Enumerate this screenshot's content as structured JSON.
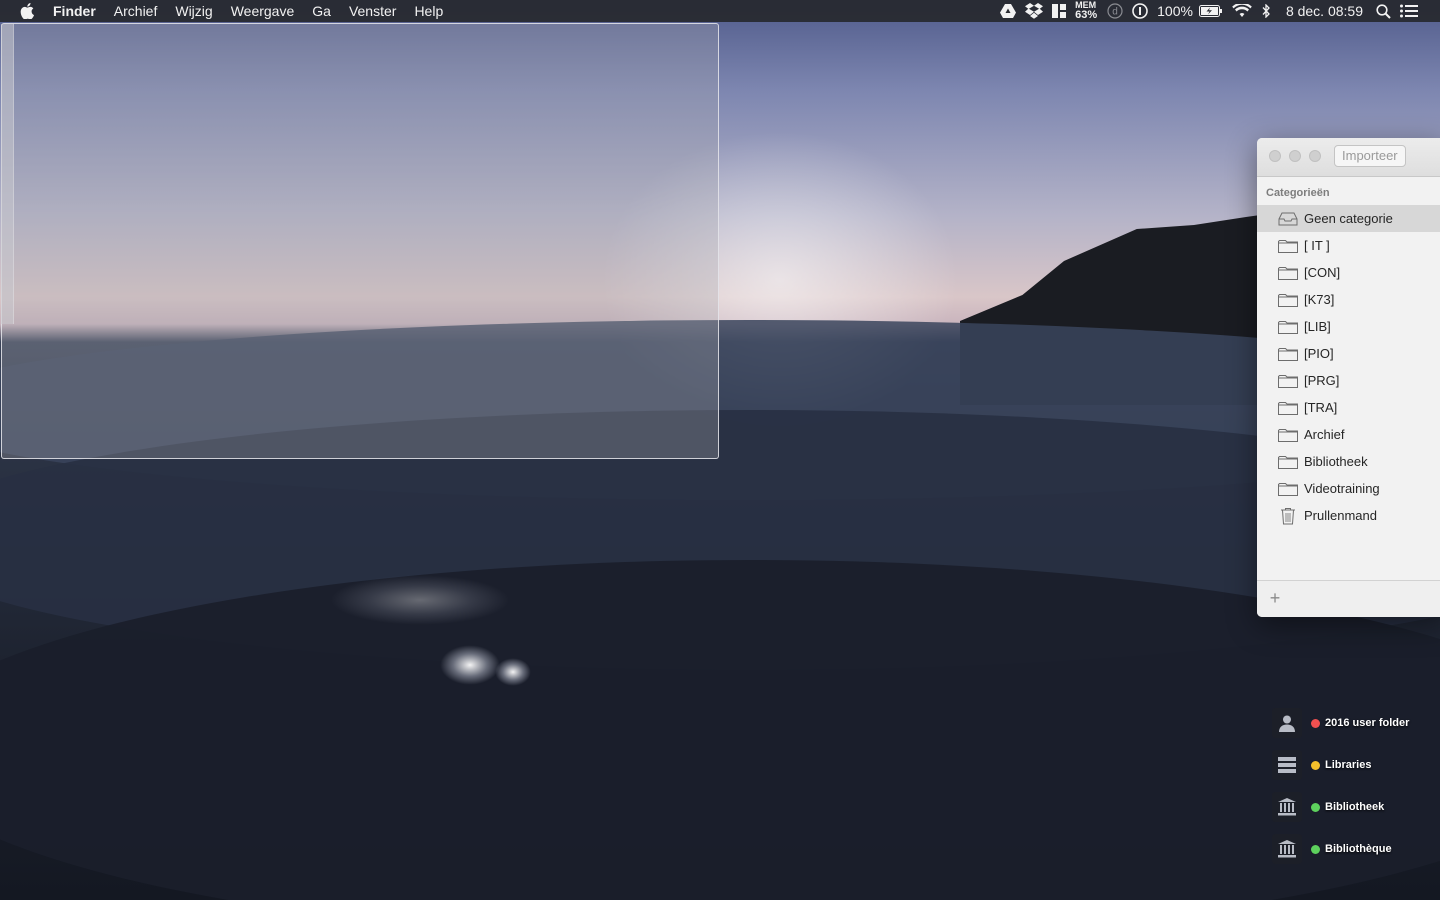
{
  "menubar": {
    "app_name": "Finder",
    "items": [
      "Archief",
      "Wijzig",
      "Weergave",
      "Ga",
      "Venster",
      "Help"
    ],
    "status": {
      "mem_label": "MEM",
      "mem_value": "63%",
      "battery": "100%",
      "clock": "8 dec. 08:59"
    },
    "icons": [
      "google-drive-icon",
      "dropbox-icon",
      "fantastical-icon",
      "mem-meter",
      "dash-icon",
      "1password-icon",
      "battery-icon",
      "wifi-icon",
      "bluetooth-icon",
      "spotlight-icon",
      "notification-center-icon"
    ]
  },
  "importer": {
    "import_button": "Importeer",
    "section_header": "Categorieën",
    "categories": [
      {
        "label": "Geen categorie",
        "icon": "inbox-icon",
        "selected": true
      },
      {
        "label": "[ IT ]",
        "icon": "folder-icon"
      },
      {
        "label": "[CON]",
        "icon": "folder-icon"
      },
      {
        "label": "[K73]",
        "icon": "folder-icon"
      },
      {
        "label": "[LIB]",
        "icon": "folder-icon"
      },
      {
        "label": "[PIO]",
        "icon": "folder-icon"
      },
      {
        "label": "[PRG]",
        "icon": "folder-icon"
      },
      {
        "label": "[TRA]",
        "icon": "folder-icon"
      },
      {
        "label": "Archief",
        "icon": "folder-icon"
      },
      {
        "label": "Bibliotheek",
        "icon": "folder-icon"
      },
      {
        "label": "Videotraining",
        "icon": "folder-icon"
      },
      {
        "label": "Prullenmand",
        "icon": "trash-icon"
      }
    ],
    "add_label": "+"
  },
  "desktop": {
    "items": [
      {
        "label": "2016 user folder",
        "icon": "user-folder-icon",
        "tag_color": "#f05050"
      },
      {
        "label": "Libraries",
        "icon": "server-icon",
        "tag_color": "#f5c02c"
      },
      {
        "label": "Bibliotheek",
        "icon": "library-icon",
        "tag_color": "#5dd15d"
      },
      {
        "label": "Bibliothèque",
        "icon": "library-icon",
        "tag_color": "#5dd15d"
      }
    ]
  },
  "colors": {
    "menubar_bg": "#26282e",
    "selection": "#d7d7d7"
  }
}
